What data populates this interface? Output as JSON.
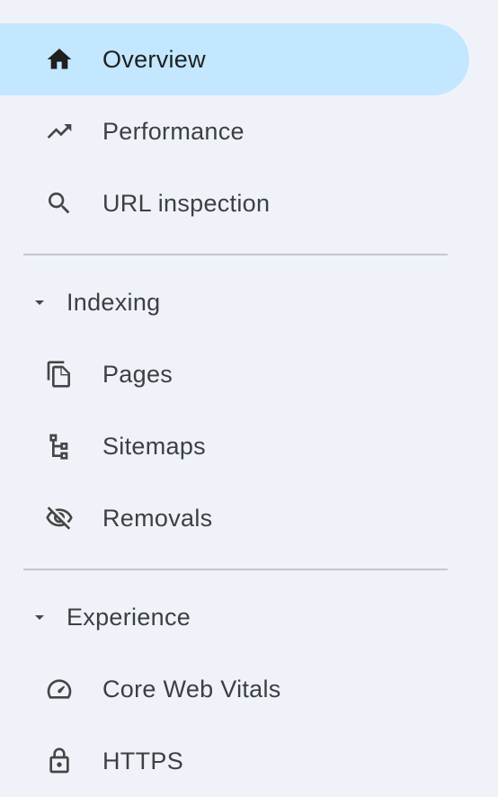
{
  "colors": {
    "background": "#eff3f9",
    "active_background": "#c2e7ff",
    "icon": "#444746",
    "text": "#3c4043",
    "divider": "#c7c7c7"
  },
  "nav": {
    "top_items": [
      {
        "label": "Overview",
        "icon": "home-icon",
        "active": true
      },
      {
        "label": "Performance",
        "icon": "trending-up-icon",
        "active": false
      },
      {
        "label": "URL inspection",
        "icon": "search-icon",
        "active": false
      }
    ],
    "sections": [
      {
        "title": "Indexing",
        "expanded": true,
        "items": [
          {
            "label": "Pages",
            "icon": "pages-icon"
          },
          {
            "label": "Sitemaps",
            "icon": "sitemap-icon"
          },
          {
            "label": "Removals",
            "icon": "eye-off-icon"
          }
        ]
      },
      {
        "title": "Experience",
        "expanded": true,
        "items": [
          {
            "label": "Core Web Vitals",
            "icon": "speedometer-icon"
          },
          {
            "label": "HTTPS",
            "icon": "lock-icon"
          }
        ]
      }
    ]
  }
}
